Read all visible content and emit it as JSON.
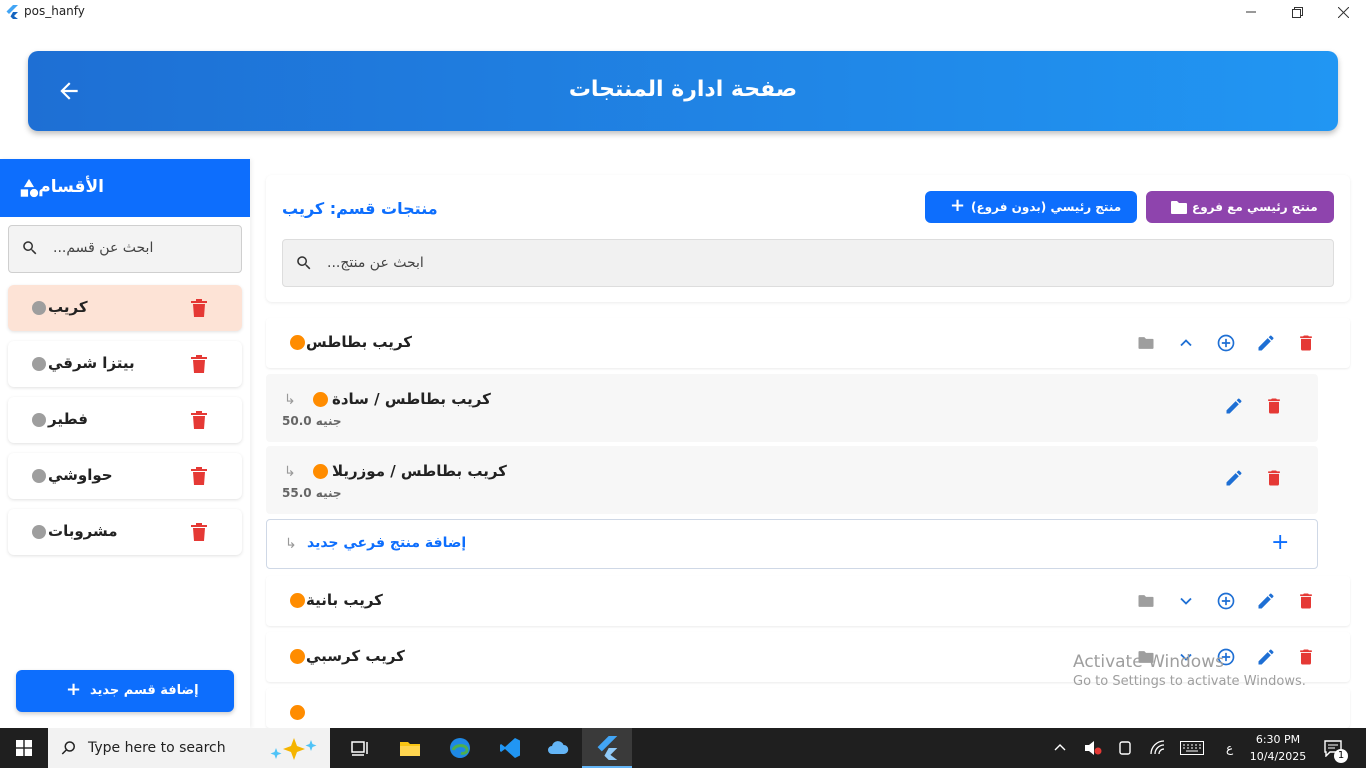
{
  "window": {
    "title": "pos_hanfy"
  },
  "header": {
    "title": "صفحة ادارة المنتجات"
  },
  "sidebar": {
    "heading": "الأقسام",
    "search_placeholder": "...ابحث عن قسم",
    "items": [
      {
        "label": "كريب",
        "active": true
      },
      {
        "label": "بيتزا شرقي",
        "active": false
      },
      {
        "label": "فطير",
        "active": false
      },
      {
        "label": "حواوشي",
        "active": false
      },
      {
        "label": "مشروبات",
        "active": false
      }
    ],
    "add_button": "إضافة قسم جديد"
  },
  "main": {
    "section_title": "منتجات قسم: كريب",
    "btn_with_branches": "منتج رئيسي مع فروع",
    "btn_without_branches": "منتج رئيسي (بدون فروع)",
    "search_placeholder": "...ابحث عن منتج",
    "products": [
      {
        "name": "كريب بطاطس",
        "expanded": true,
        "children": [
          {
            "name": "كريب بطاطس / سادة",
            "price": "50.0 جنيه"
          },
          {
            "name": "كريب بطاطس / موزريلا",
            "price": "55.0 جنيه"
          }
        ],
        "add_child_label": "إضافة منتج فرعي جديد"
      },
      {
        "name": "كريب بانية",
        "expanded": false
      },
      {
        "name": "كريب كرسبي",
        "expanded": false
      }
    ]
  },
  "watermark": {
    "line1": "Activate Windows",
    "line2": "Go to Settings to activate Windows."
  },
  "taskbar": {
    "search_placeholder": "Type here to search",
    "time": "6:30 PM",
    "date": "10/4/2025",
    "lang": "ع",
    "notification_count": "1"
  },
  "colors": {
    "primary": "#0d6efd",
    "purple": "#8e44ad",
    "orange_dot": "#ff8c00",
    "delete_red": "#e53935",
    "active_category_bg": "#fde3d6"
  }
}
